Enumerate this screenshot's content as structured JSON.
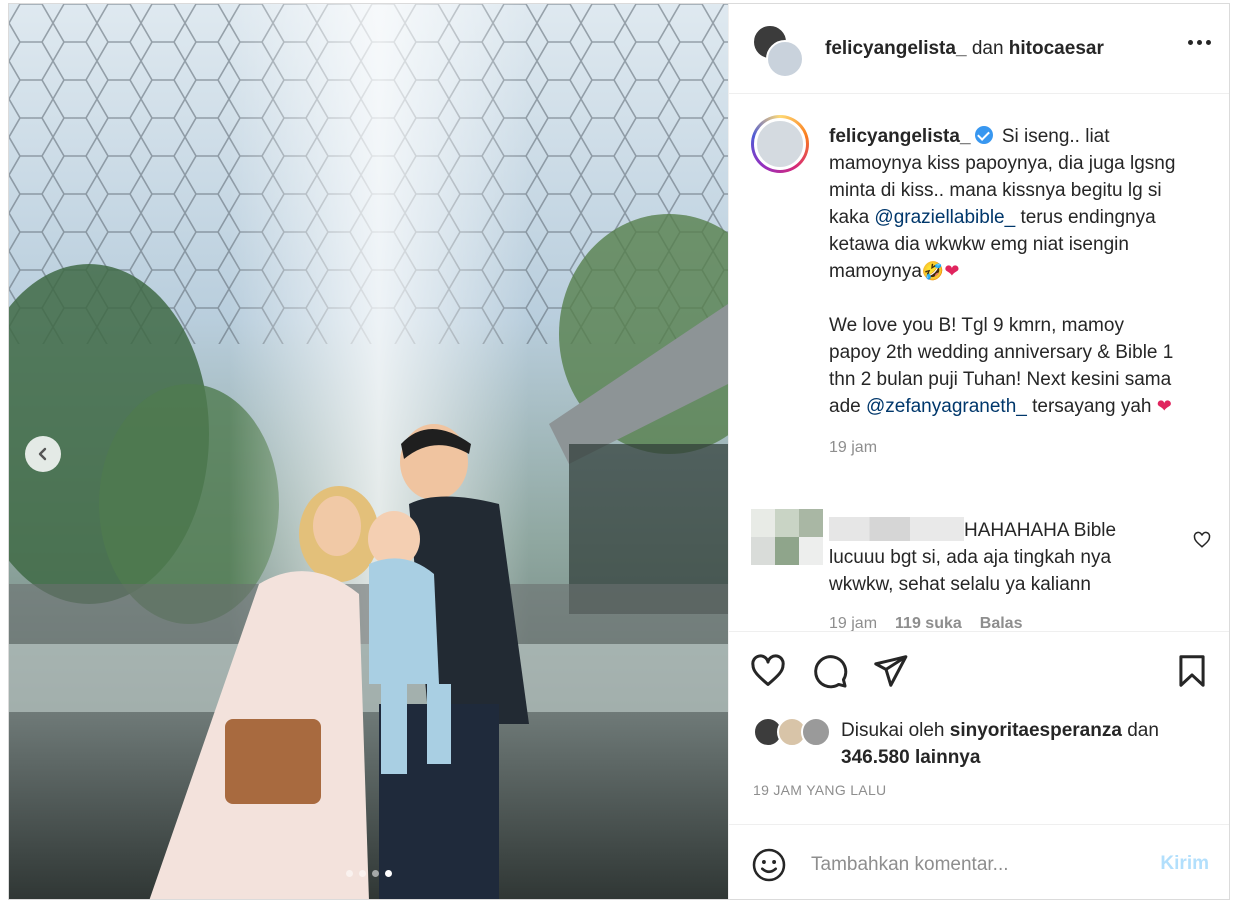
{
  "header": {
    "user1": "felicyangelista_",
    "conjunction": "dan",
    "user2": "hitocaesar",
    "more_icon": "more-horizontal-icon"
  },
  "caption": {
    "username": "felicyangelista_",
    "para1_a": "Si iseng.. liat mamoynya kiss papoynya, dia juga lgsng minta di kiss.. mana kissnya begitu lg si kaka ",
    "mention1": "@graziellabible_",
    "para1_b": " terus endingnya ketawa dia wkwkw emg niat isengin mamoynya",
    "emoji_laugh": "🤣",
    "emoji_heart": "❤",
    "para2_a": "We love you B! Tgl 9 kmrn, mamoy papoy 2th wedding anniversary & Bible 1 thn 2 bulan puji Tuhan! Next kesini sama ade ",
    "mention2": "@zefanyagraneth_",
    "para2_b": " tersayang yah ",
    "time": "19 jam"
  },
  "comment": {
    "text": "HAHAHAHA Bible lucuuu bgt si, ada aja tingkah nya wkwkw, sehat selalu ya kaliann",
    "time": "19 jam",
    "likes": "119 suka",
    "reply": "Balas"
  },
  "likes": {
    "prefix": "Disukai oleh ",
    "user": "sinyoritaesperanza",
    "middle": " dan",
    "count": "346.580 lainnya"
  },
  "posted": "19 JAM YANG LALU",
  "add_comment": {
    "placeholder": "Tambahkan komentar...",
    "send": "Kirim"
  },
  "carousel": {
    "count": 4,
    "active": 4
  },
  "colors": {
    "accent": "#0095f6",
    "send_disabled": "#b2dffc",
    "mention": "#00376b"
  }
}
